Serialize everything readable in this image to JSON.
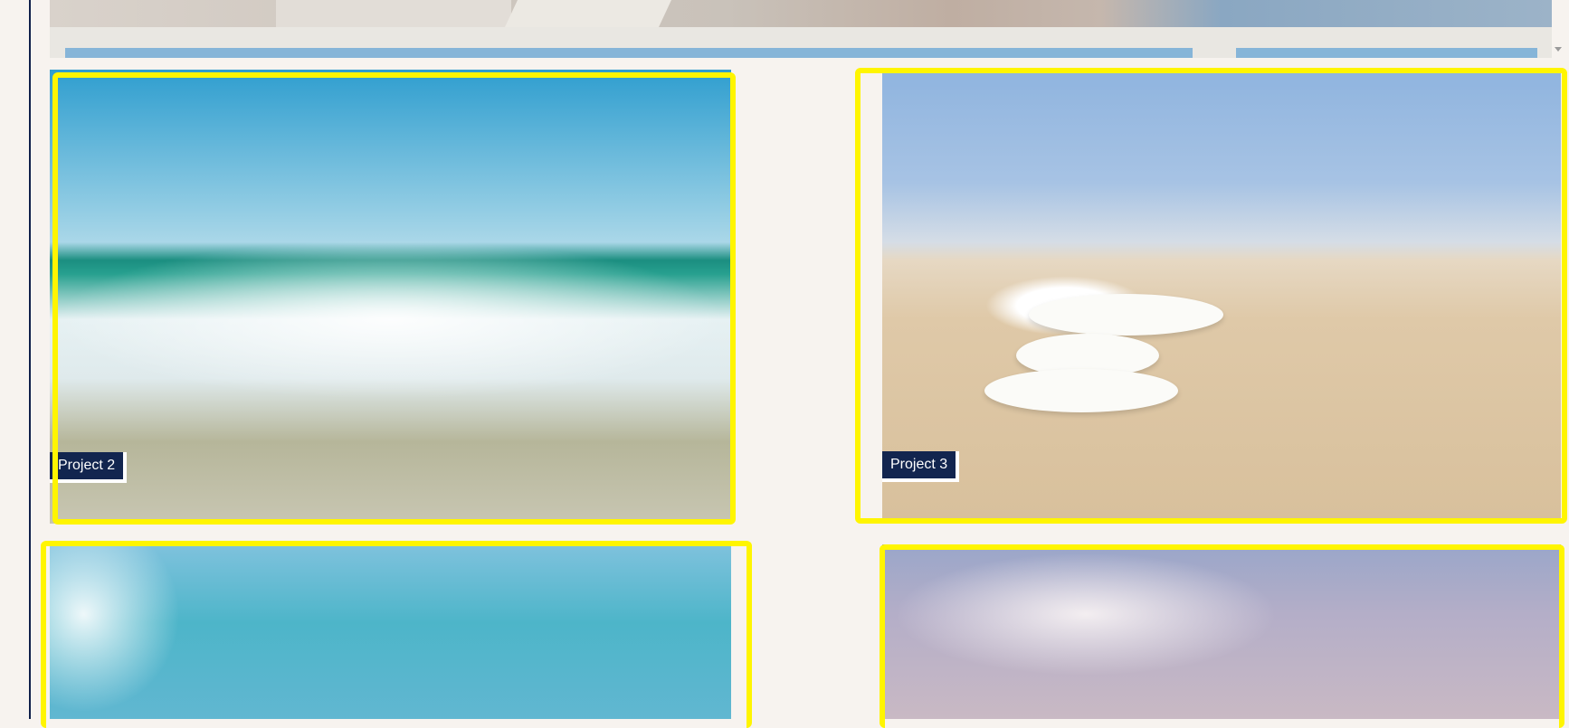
{
  "gallery": {
    "items": [
      {
        "label": "Project 2",
        "image": "ocean-wave-splash"
      },
      {
        "label": "Project 3",
        "image": "stacked-stones-on-beach"
      },
      {
        "label": "",
        "image": "turquoise-water-splash"
      },
      {
        "label": "",
        "image": "cloudy-sky"
      }
    ]
  },
  "highlight_color": "#fff500",
  "label_background": "#12254f",
  "scrollbar_color": "#86b5d8"
}
